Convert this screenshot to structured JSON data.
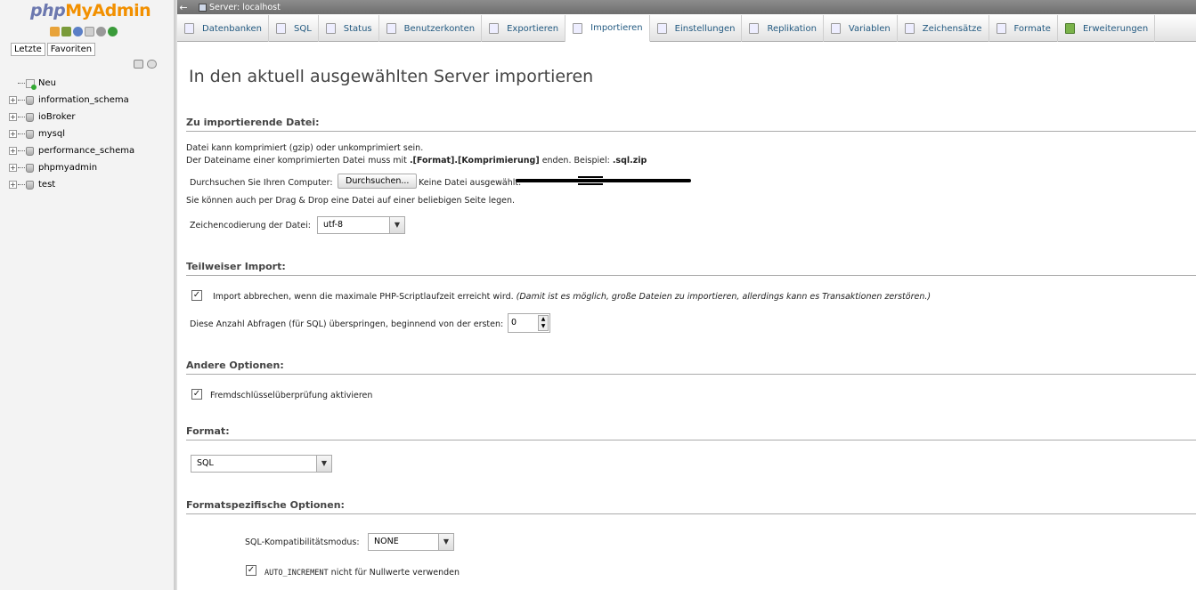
{
  "logo": {
    "part1": "php",
    "part2": "MyAdmin"
  },
  "nav": {
    "tabs": [
      "Letzte",
      "Favoriten"
    ],
    "new_label": "Neu",
    "databases": [
      "information_schema",
      "ioBroker",
      "mysql",
      "performance_schema",
      "phpmyadmin",
      "test"
    ]
  },
  "serverbar": {
    "title": "Server: localhost",
    "back": "←"
  },
  "tabs": [
    {
      "label": "Datenbanken",
      "icon": "database-icon"
    },
    {
      "label": "SQL",
      "icon": "sql-icon"
    },
    {
      "label": "Status",
      "icon": "status-icon"
    },
    {
      "label": "Benutzerkonten",
      "icon": "users-icon"
    },
    {
      "label": "Exportieren",
      "icon": "export-icon"
    },
    {
      "label": "Importieren",
      "icon": "import-icon"
    },
    {
      "label": "Einstellungen",
      "icon": "wrench-icon"
    },
    {
      "label": "Replikation",
      "icon": "replication-icon"
    },
    {
      "label": "Variablen",
      "icon": "variables-icon"
    },
    {
      "label": "Zeichensätze",
      "icon": "charset-icon"
    },
    {
      "label": "Formate",
      "icon": "formats-icon"
    },
    {
      "label": "Erweiterungen",
      "icon": "plugin-icon"
    }
  ],
  "page_title": "In den aktuell ausgewählten Server importieren",
  "file_section": {
    "legend": "Zu importierende Datei:",
    "line1": "Datei kann komprimiert (gzip) oder unkomprimiert sein.",
    "line2_a": "Der Dateiname einer komprimierten Datei muss mit ",
    "line2_b": ".[Format].[Komprimierung]",
    "line2_c": " enden. Beispiel: ",
    "line2_d": ".sql.zip",
    "browse_label": "Durchsuchen Sie Ihren Computer:",
    "browse_button": "Durchsuchen...",
    "no_file": "Keine Datei ausgewählt.",
    "drag_hint": "Sie können auch per Drag & Drop eine Datei auf einer beliebigen Seite legen.",
    "charset_label": "Zeichencodierung der Datei:",
    "charset_value": "utf-8"
  },
  "partial_section": {
    "legend": "Teilweiser Import:",
    "abort_label": "Import abbrechen, wenn die maximale PHP-Scriptlaufzeit erreicht wird. ",
    "abort_note": "(Damit ist es möglich, große Dateien zu importieren, allerdings kann es Transaktionen zerstören.)",
    "abort_checked": true,
    "skip_label": "Diese Anzahl Abfragen (für SQL) überspringen, beginnend von der ersten:",
    "skip_value": "0"
  },
  "other_section": {
    "legend": "Andere Optionen:",
    "fk_label": "Fremdschlüsselüberprüfung aktivieren",
    "fk_checked": true
  },
  "format_section": {
    "legend": "Format:",
    "value": "SQL"
  },
  "format_specific": {
    "legend": "Formatspezifische Optionen:",
    "compat_label": "SQL-Kompatibilitätsmodus:",
    "compat_value": "NONE",
    "auto_inc_code": "AUTO_INCREMENT",
    "auto_inc_label": " nicht für Nullwerte verwenden",
    "auto_inc_checked": true
  },
  "colors": {
    "tab_text": "#235a81",
    "serverbar": "#7a7a7a",
    "logo_blue": "#6c78af",
    "logo_orange": "#f29000"
  }
}
